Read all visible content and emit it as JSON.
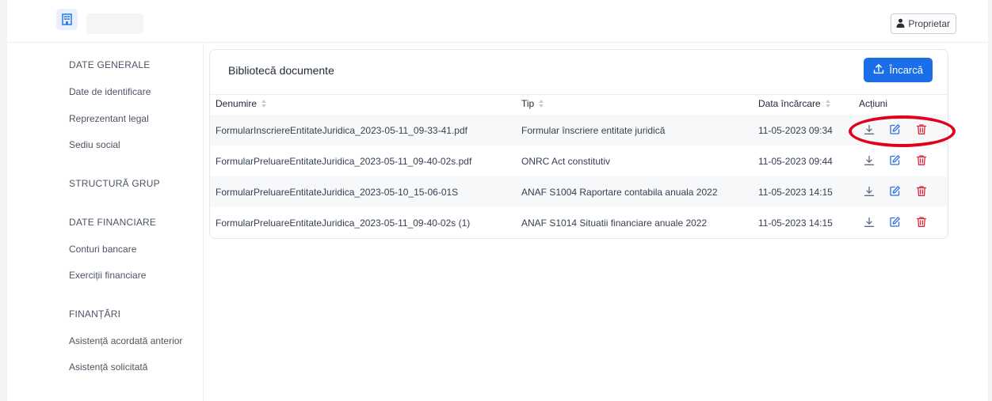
{
  "header": {
    "role_button": "Proprietar"
  },
  "sidebar": {
    "section_general": "DATE GENERALE",
    "item_identificare": "Date de identificare",
    "item_reprezentant": "Reprezentant legal",
    "item_sediu": "Sediu social",
    "section_structura": "STRUCTURĂ GRUP",
    "section_financiare": "DATE FINANCIARE",
    "item_conturi": "Conturi bancare",
    "item_exercitii": "Exerciții financiare",
    "section_finantari": "FINANȚĂRI",
    "item_asistenta_anterior": "Asistență acordată anterior",
    "item_asistenta_solicitata": "Asistență solicitată"
  },
  "library": {
    "title": "Bibliotecă documente",
    "upload_label": "Încarcă",
    "columns": {
      "name": "Denumire",
      "type": "Tip",
      "date": "Data încărcare",
      "actions": "Acțiuni"
    },
    "rows": [
      {
        "name": "FormularInscriereEntitateJuridica_2023-05-11_09-33-41.pdf",
        "type": "Formular înscriere entitate juridică",
        "date": "11-05-2023 09:34"
      },
      {
        "name": "FormularPreluareEntitateJuridica_2023-05-11_09-40-02s.pdf",
        "type": "ONRC Act constitutiv",
        "date": "11-05-2023 09:44"
      },
      {
        "name": "FormularPreluareEntitateJuridica_2023-05-10_15-06-01S",
        "type": "ANAF S1004 Raportare contabila anuala 2022",
        "date": "11-05-2023 14:15"
      },
      {
        "name": "FormularPreluareEntitateJuridica_2023-05-11_09-40-02s (1)",
        "type": "ANAF S1014 Situatii financiare anuale 2022",
        "date": "11-05-2023 14:15"
      }
    ]
  },
  "colors": {
    "primary": "#1a6fe8",
    "edit_icon": "#2f6fe0",
    "delete_icon": "#e0263a",
    "download_icon": "#5b6b84",
    "highlight_circle": "#e0001a"
  },
  "icons": {
    "logo": "building-icon",
    "role": "user-icon",
    "upload": "upload-icon",
    "download": "download-icon",
    "edit": "edit-icon",
    "delete": "trash-icon"
  }
}
